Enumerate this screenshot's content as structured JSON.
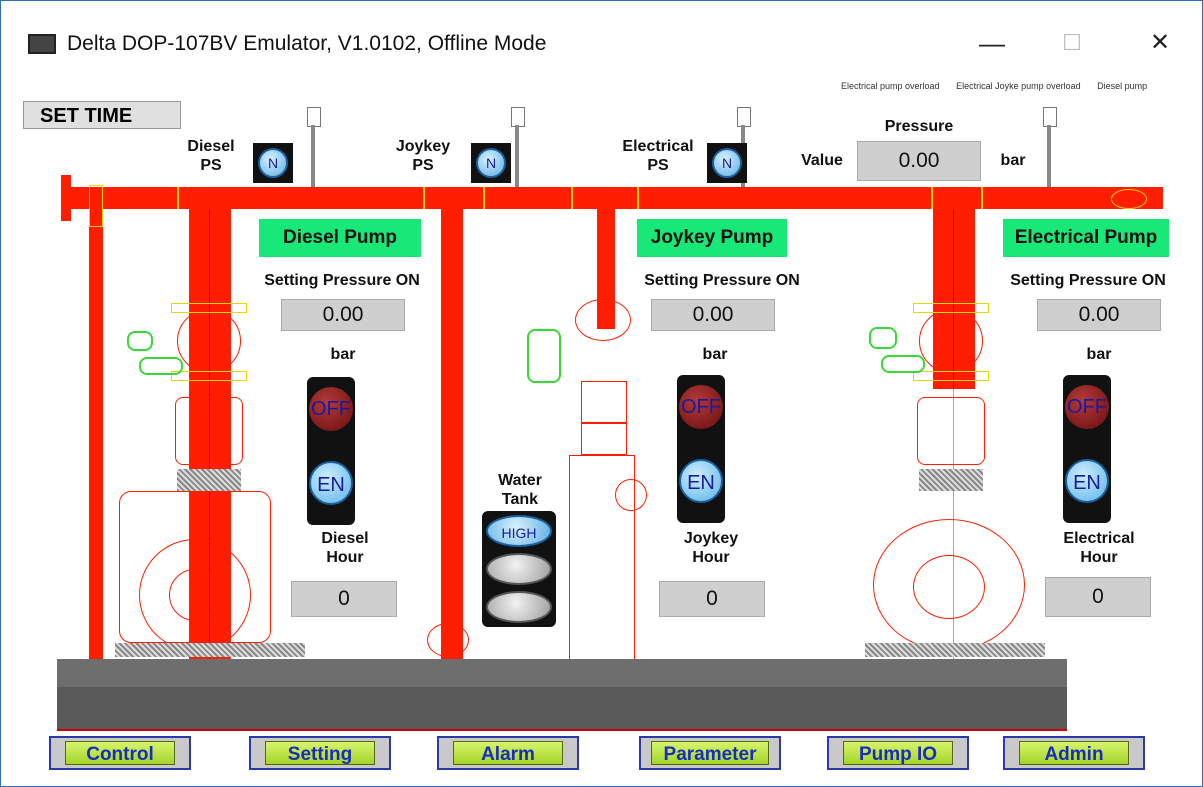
{
  "window": {
    "title": "Delta DOP-107BV Emulator, V1.0102, Offline Mode",
    "minimize_glyph": "—",
    "maximize_glyph": "☐",
    "close_glyph": "✕"
  },
  "alarm_ticker": [
    "Electrical pump overload",
    "Electrical Joyke pump overload",
    "Diesel pump"
  ],
  "set_time_label": "SET TIME",
  "switches": {
    "diesel": {
      "label_1": "Diesel",
      "label_2": "PS",
      "state": "N"
    },
    "joykey": {
      "label_1": "Joykey",
      "label_2": "PS",
      "state": "N"
    },
    "electrical": {
      "label_1": "Electrical",
      "label_2": "PS",
      "state": "N"
    }
  },
  "pressure": {
    "title": "Pressure",
    "value_label": "Value",
    "value": "0.00",
    "unit": "bar"
  },
  "pumps": {
    "diesel": {
      "name": "Diesel Pump",
      "setting_label": "Setting Pressure ON",
      "setting_value": "0.00",
      "unit": "bar",
      "off_label": "OFF",
      "en_label": "EN",
      "hour_label_1": "Diesel",
      "hour_label_2": "Hour",
      "hour_value": "0"
    },
    "joykey": {
      "name": "Joykey Pump",
      "setting_label": "Setting Pressure ON",
      "setting_value": "0.00",
      "unit": "bar",
      "off_label": "OFF",
      "en_label": "EN",
      "hour_label_1": "Joykey",
      "hour_label_2": "Hour",
      "hour_value": "0"
    },
    "electrical": {
      "name": "Electrical Pump",
      "setting_label": "Setting Pressure ON",
      "setting_value": "0.00",
      "unit": "bar",
      "off_label": "OFF",
      "en_label": "EN",
      "hour_label_1": "Electrical",
      "hour_label_2": "Hour",
      "hour_value": "0"
    }
  },
  "water_tank": {
    "label_1": "Water",
    "label_2": "Tank",
    "high_label": "HIGH"
  },
  "nav": {
    "control": "Control",
    "setting": "Setting",
    "alarm": "Alarm",
    "parameter": "Parameter",
    "pump_io": "Pump IO",
    "admin": "Admin"
  },
  "colors": {
    "pipe": "#ff1e00",
    "pump_label_bg": "#17e878",
    "nav_button": "#a4d42a",
    "nav_text": "#1a2bbf"
  }
}
